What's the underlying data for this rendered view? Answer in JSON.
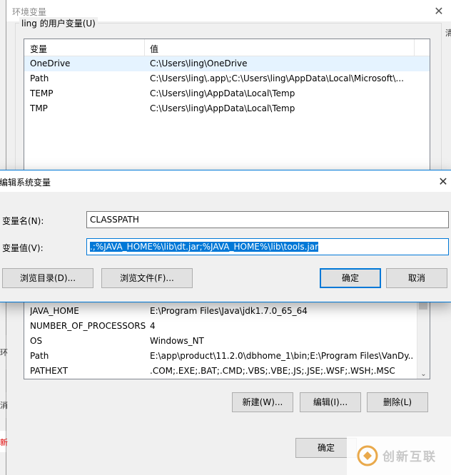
{
  "env_window": {
    "title": "环境变量",
    "close_glyph": "✕",
    "user_group_label": "ling 的用户变量(U)",
    "user_vars": {
      "headers": [
        "变量",
        "值"
      ],
      "rows": [
        {
          "name": "OneDrive",
          "value": "C:\\Users\\ling\\OneDrive"
        },
        {
          "name": "Path",
          "value": "C:\\Users\\ling\\.app\\;C:\\Users\\ling\\AppData\\Local\\Microsoft\\..."
        },
        {
          "name": "TEMP",
          "value": "C:\\Users\\ling\\AppData\\Local\\Temp"
        },
        {
          "name": "TMP",
          "value": "C:\\Users\\ling\\AppData\\Local\\Temp"
        }
      ]
    },
    "system_vars": {
      "rows": [
        {
          "name": "JAVA_HOME",
          "value": "E:\\Program Files\\Java\\jdk1.7.0_65_64"
        },
        {
          "name": "NUMBER_OF_PROCESSORS",
          "value": "4"
        },
        {
          "name": "OS",
          "value": "Windows_NT"
        },
        {
          "name": "Path",
          "value": "E:\\app\\product\\11.2.0\\dbhome_1\\bin;E:\\Program Files\\VanDy..."
        },
        {
          "name": "PATHEXT",
          "value": ".COM;.EXE;.BAT;.CMD;.VBS;.VBE;.JS;.JSE;.WSF;.WSH;.MSC"
        }
      ]
    },
    "system_buttons": {
      "new": "新建(W)...",
      "edit": "编辑(I)...",
      "delete": "删除(L)"
    },
    "ok": "确定",
    "side_fragments": {
      "right_top": "清",
      "left1": "环",
      "left2": "消",
      "left3": "新"
    }
  },
  "edit_dialog": {
    "title": "编辑系统变量",
    "close_glyph": "✕",
    "name_label": "变量名(N):",
    "name_value": "CLASSPATH",
    "value_label": "变量值(V):",
    "value_value": ".;%JAVA_HOME%\\lib\\dt.jar;%JAVA_HOME%\\lib\\tools.jar",
    "browse_dir": "浏览目录(D)...",
    "browse_file": "浏览文件(F)...",
    "ok": "确定",
    "cancel": "取消"
  },
  "watermark": {
    "text": "创新互联"
  }
}
